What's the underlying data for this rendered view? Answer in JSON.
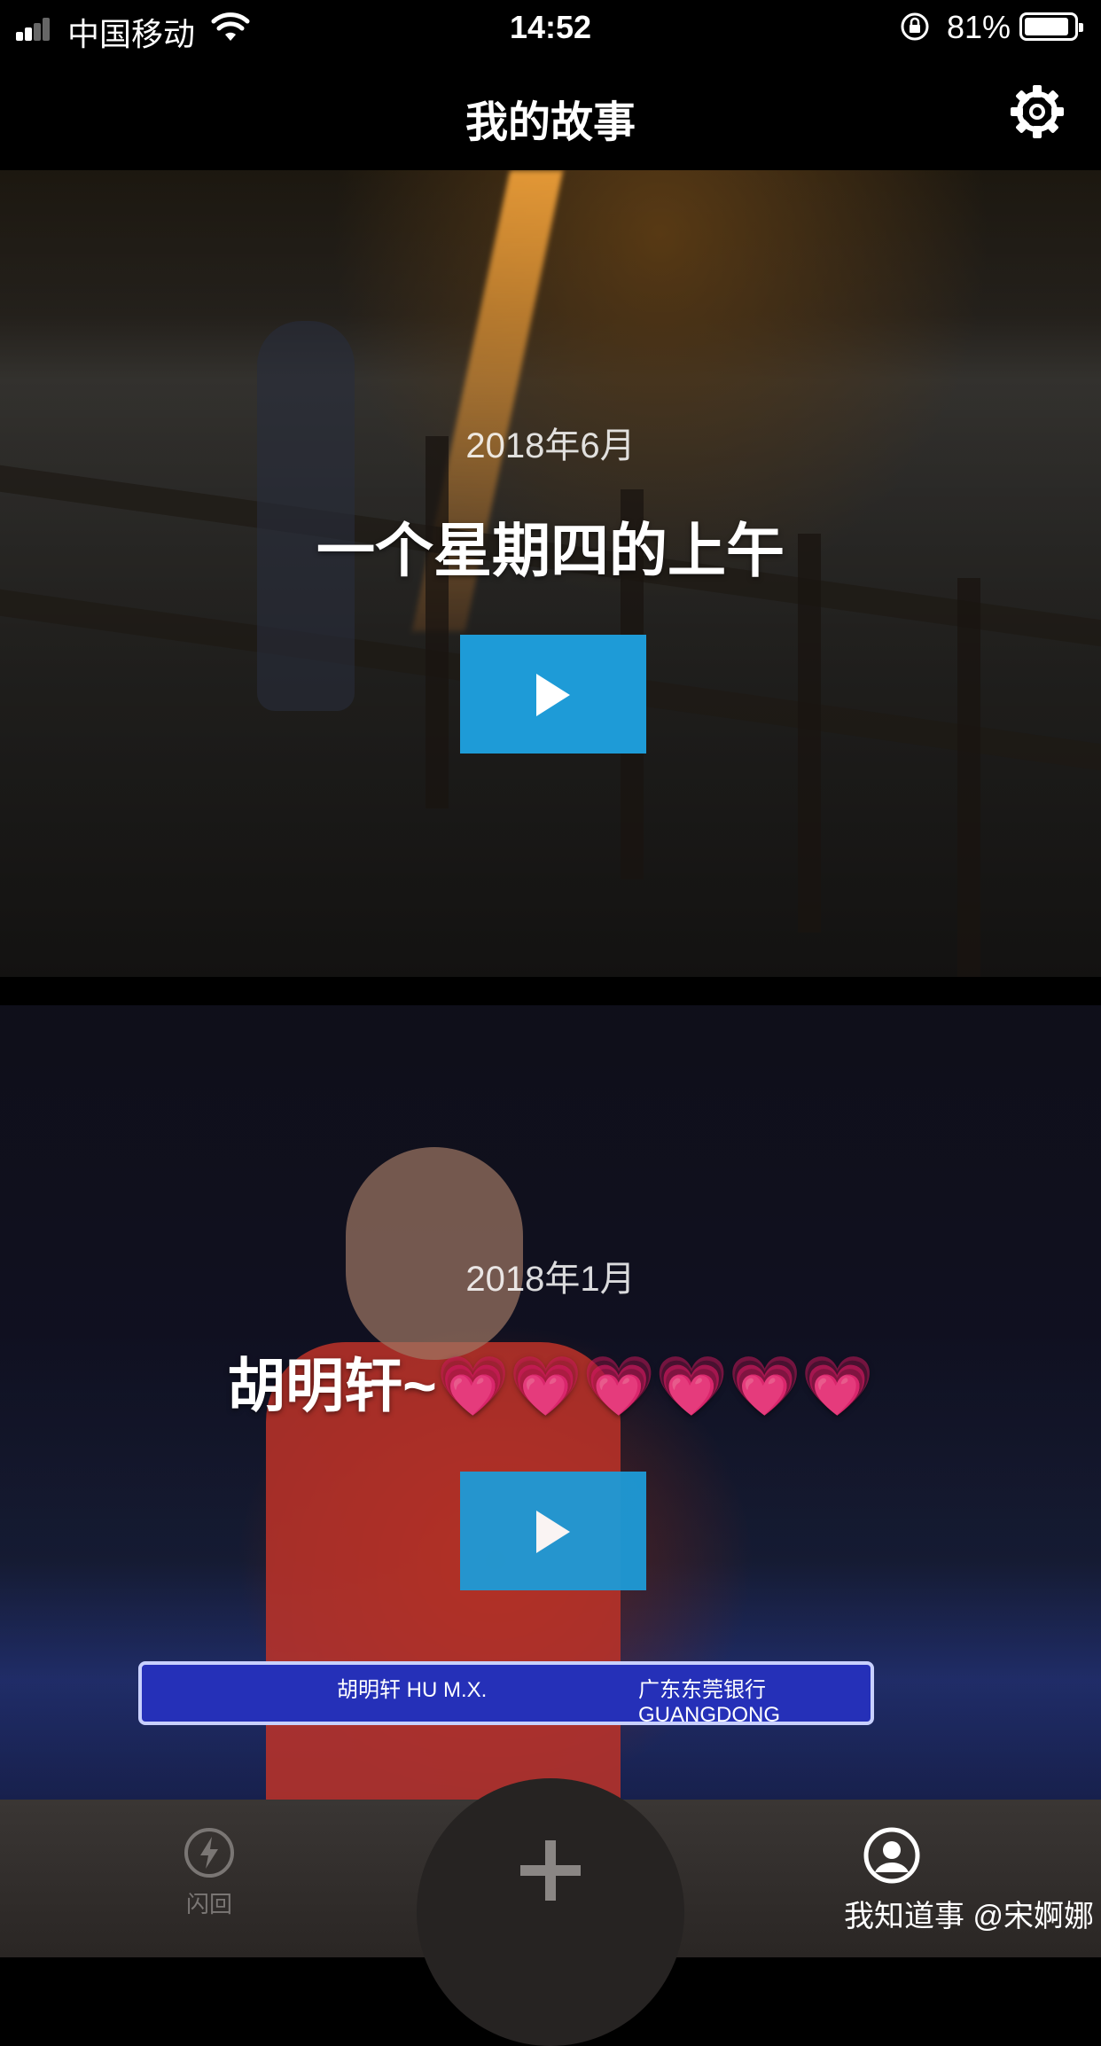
{
  "status_bar": {
    "carrier": "中国移动",
    "time": "14:52",
    "battery_percent": "81%"
  },
  "nav": {
    "title": "我的故事",
    "settings_icon": "gear-icon"
  },
  "stories": [
    {
      "date": "2018年6月",
      "title": "一个星期四的上午",
      "play_icon": "play-icon"
    },
    {
      "date": "2018年1月",
      "title": "胡明轩~💗💗💗💗💗💗",
      "play_icon": "play-icon",
      "broadcast_name": "胡明轩 HU M.X.",
      "broadcast_team": "广东东莞银行 GUANGDONG"
    }
  ],
  "tab_bar": {
    "left_label": "闪回",
    "left_icon": "flash-icon",
    "center_icon": "plus-icon",
    "right_icon": "profile-icon"
  },
  "watermark": "我知道事 @宋婀娜",
  "colors": {
    "accent": "#1e9bd7",
    "tab_inactive": "#7a7674",
    "background": "#000000"
  }
}
